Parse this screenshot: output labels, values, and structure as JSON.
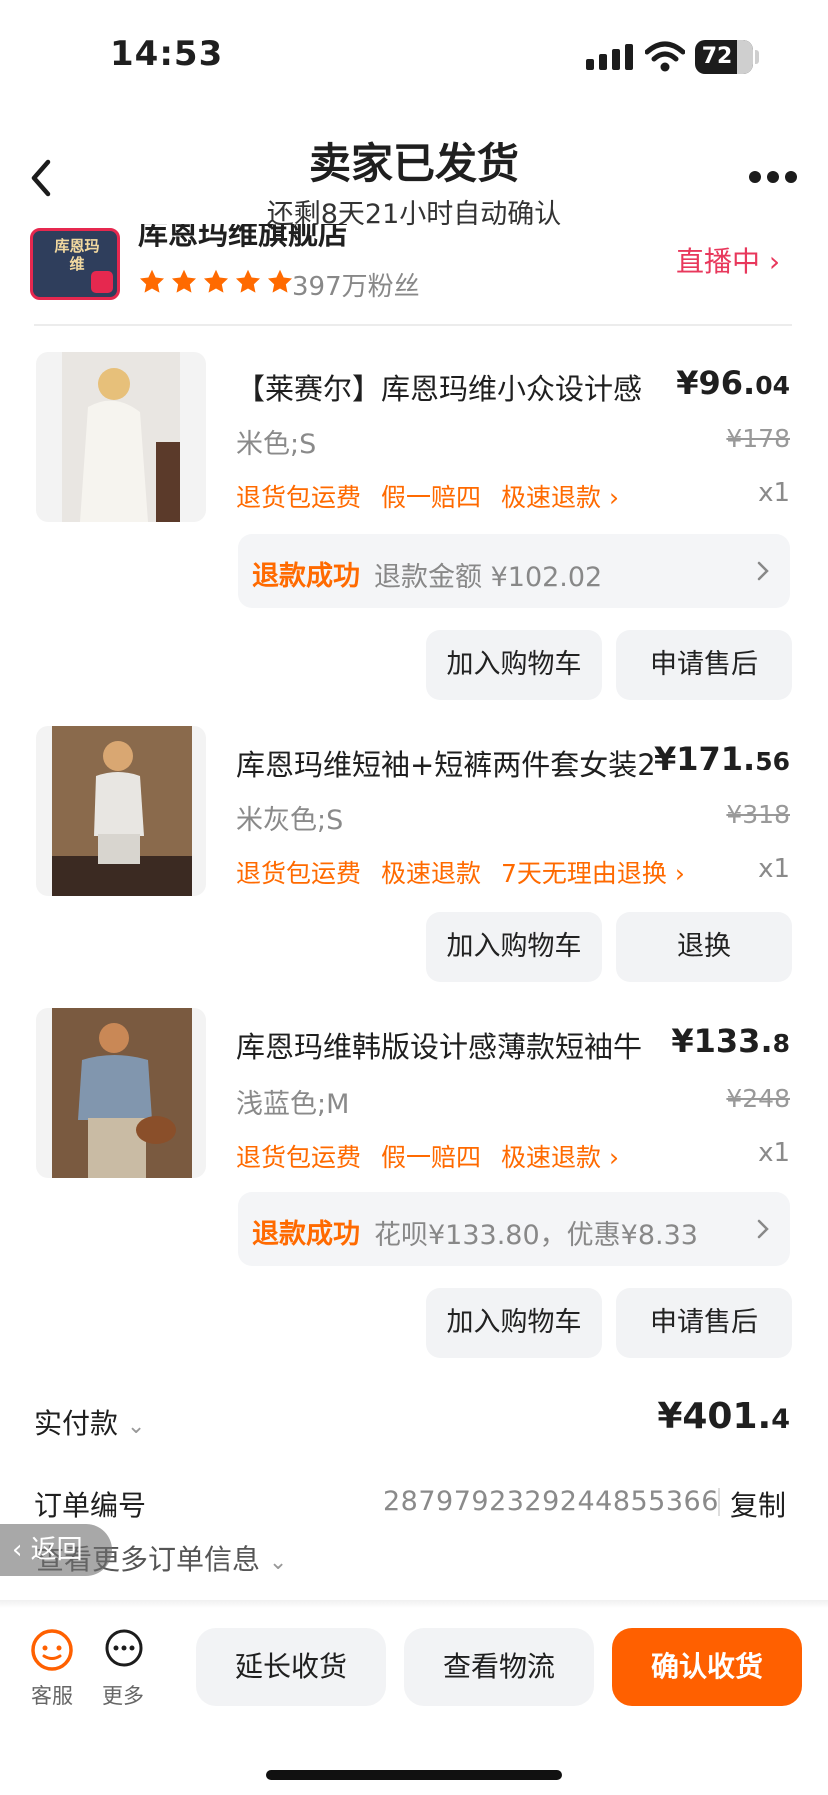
{
  "status_bar": {
    "time": "14:53",
    "battery": "72"
  },
  "header": {
    "title": "卖家已发货",
    "subtitle": "还剩8天21小时自动确认"
  },
  "shop": {
    "name": "库恩玛维旗舰店",
    "logo_text": "库恩玛维",
    "rating_stars": 5,
    "fans": "397万粉丝",
    "live_label": "直播中"
  },
  "items": [
    {
      "title": "【莱赛尔】库恩玛维小众设计感",
      "price_main": "¥96.",
      "price_dec": "04",
      "orig_price": "¥178",
      "spec": "米色;S",
      "tags": [
        "退货包运费",
        "假一赔四",
        "极速退款 ›"
      ],
      "qty": "x1",
      "refund": {
        "label": "退款成功",
        "text": "退款金额 ¥102.02"
      },
      "buttons": [
        "加入购物车",
        "申请售后"
      ]
    },
    {
      "title": "库恩玛维短袖+短裤两件套女装2",
      "price_main": "¥171.",
      "price_dec": "56",
      "orig_price": "¥318",
      "spec": "米灰色;S",
      "tags": [
        "退货包运费",
        "极速退款",
        "7天无理由退换 ›"
      ],
      "qty": "x1",
      "buttons": [
        "加入购物车",
        "退换"
      ]
    },
    {
      "title": "库恩玛维韩版设计感薄款短袖牛",
      "price_main": "¥133.",
      "price_dec": "8",
      "orig_price": "¥248",
      "spec": "浅蓝色;M",
      "tags": [
        "退货包运费",
        "假一赔四",
        "极速退款 ›"
      ],
      "qty": "x1",
      "refund": {
        "label": "退款成功",
        "text": "花呗¥133.80，优惠¥8.33"
      },
      "buttons": [
        "加入购物车",
        "申请售后"
      ]
    }
  ],
  "summary": {
    "paid_label": "实付款",
    "paid_main": "¥401.",
    "paid_dec": "4",
    "order_label": "订单编号",
    "order_no": "2879792329244855366",
    "copy": "复制",
    "more_info": "查看更多订单信息",
    "float_back": "返回"
  },
  "bottom_bar": {
    "service": "客服",
    "more": "更多",
    "extend": "延长收货",
    "logistics": "查看物流",
    "confirm": "确认收货"
  },
  "colors": {
    "accent": "#ff6000",
    "live": "#e8385c",
    "tag": "#ff6a00"
  }
}
